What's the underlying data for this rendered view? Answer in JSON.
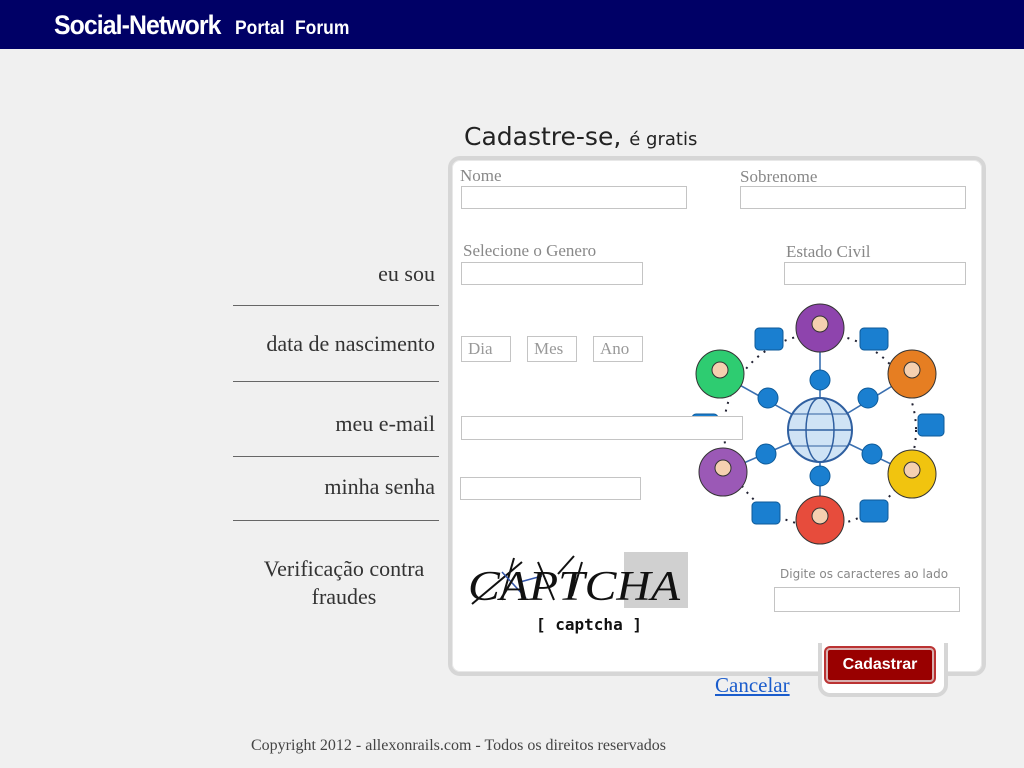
{
  "header": {
    "brand": "Social-Network",
    "nav": [
      "Portal",
      "Forum"
    ]
  },
  "form": {
    "title": "Cadastre-se,",
    "title_suffix": "é gratis",
    "fields": {
      "nome": "Nome",
      "sobrenome": "Sobrenome",
      "genero": "Selecione o Genero",
      "estado_civil": "Estado Civil",
      "dia_placeholder": "Dia",
      "mes_placeholder": "Mes",
      "ano_placeholder": "Ano"
    },
    "side_labels": {
      "eu_sou": "eu sou",
      "nascimento": "data de nascimento",
      "email": "meu e-mail",
      "senha": "minha senha",
      "verificacao": "Verificação contra fraudes"
    },
    "captcha": {
      "text": "CAPTCHA",
      "caption": "[ captcha ]",
      "hint": "Digite os caracteres ao lado"
    },
    "submit_label": "Cadastrar",
    "cancel_label": "Cancelar"
  },
  "footer": {
    "copyright": "Copyright 2012 - allexonrails.com - Todos os direitos reservados"
  },
  "colors": {
    "header_bg": "#000066",
    "submit_bg": "#990000",
    "link": "#1a5ccc"
  }
}
